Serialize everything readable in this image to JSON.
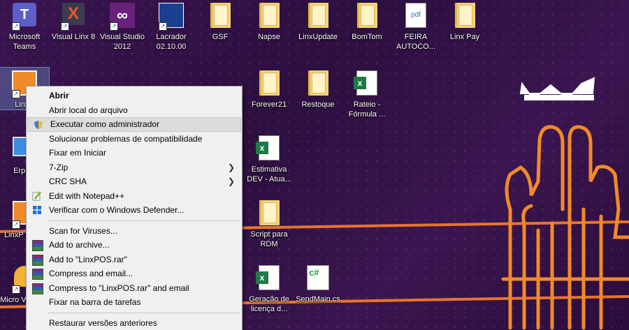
{
  "desktop": {
    "icons": [
      {
        "label": "Microsoft Teams",
        "kind": "teams"
      },
      {
        "label": "Visual Linx 8",
        "kind": "app"
      },
      {
        "label": "Visual Studio 2012",
        "kind": "vs"
      },
      {
        "label": "Lacrador 02.10.00",
        "kind": "app"
      },
      {
        "label": "GSF",
        "kind": "folder"
      },
      {
        "label": "Napse",
        "kind": "folder"
      },
      {
        "label": "LinxUpdate",
        "kind": "folder"
      },
      {
        "label": "BomTom",
        "kind": "folder"
      },
      {
        "label": "FEIRA AUTOCO...",
        "kind": "pdf"
      },
      {
        "label": "Linx Pay",
        "kind": "folder"
      },
      {
        "label": "LinxP",
        "kind": "app"
      },
      {
        "label": "Forever21",
        "kind": "folder"
      },
      {
        "label": "Restoque",
        "kind": "folder"
      },
      {
        "label": "Rateio - Fórmula ...",
        "kind": "excel"
      },
      {
        "label": "ErpLin",
        "kind": "app"
      },
      {
        "label": "Estimativa DEV - Atua...",
        "kind": "excel"
      },
      {
        "label": "LinxP Mana",
        "kind": "app"
      },
      {
        "label": "Script para RDM",
        "kind": "folder"
      },
      {
        "label": "Micro Visual F",
        "kind": "app"
      },
      {
        "label": "Geração de licença d...",
        "kind": "excel"
      },
      {
        "label": "SendMain.cs",
        "kind": "cs"
      }
    ]
  },
  "context_menu": {
    "items": [
      {
        "label": "Abrir"
      },
      {
        "label": "Abrir local do arquivo"
      },
      {
        "label": "Executar como administrador"
      },
      {
        "label": "Solucionar problemas de compatibilidade"
      },
      {
        "label": "Fixar em Iniciar"
      },
      {
        "label": "7-Zip"
      },
      {
        "label": "CRC SHA"
      },
      {
        "label": "Edit with Notepad++"
      },
      {
        "label": "Verificar com o Windows Defender..."
      },
      {
        "label": "Scan for Viruses..."
      },
      {
        "label": "Add to archive..."
      },
      {
        "label": "Add to \"LinxPOS.rar\""
      },
      {
        "label": "Compress and email..."
      },
      {
        "label": "Compress to \"LinxPOS.rar\" and email"
      },
      {
        "label": "Fixar na barra de tarefas"
      },
      {
        "label": "Restaurar versões anteriores"
      }
    ]
  },
  "colors": {
    "accent_orange": "#f07a1e",
    "wallpaper_purple": "#35124a",
    "menu_bg": "#f0f0f0"
  }
}
